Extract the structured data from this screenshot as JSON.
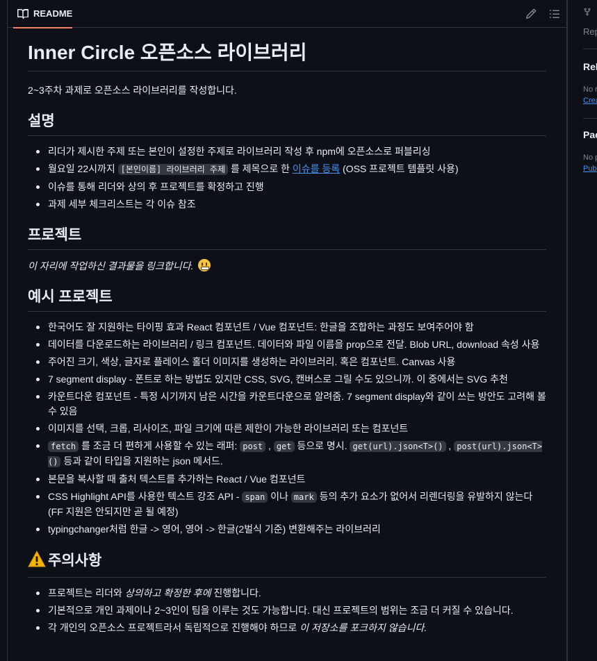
{
  "readme": {
    "tab_label": "README",
    "title": "Inner Circle 오픈소스 라이브러리",
    "intro": "2~3주차 과제로 오픈소스 라이브러리를 작성합니다.",
    "section_description": {
      "heading": "설명",
      "item1": "리더가 제시한 주제 또는 본인이 설정한 주제로 라이브러리 작성 후 npm에 오픈소스로 퍼블리싱",
      "item2_pre": "월요일 22시까지 ",
      "item2_code": "[본인이름] 라이브러리 주제",
      "item2_mid": " 를 제목으로 한 ",
      "item2_link": "이슈를 등록",
      "item2_post": " (OSS 프로젝트 템플릿 사용)",
      "item3": "이슈를 통해 리더와 상의 후 프로젝트를 확정하고 진행",
      "item4": "과제 세부 체크리스트는 각 이슈 참조"
    },
    "section_project": {
      "heading": "프로젝트",
      "note": "이 자리에 작업하신 결과물을 링크합니다."
    },
    "section_examples": {
      "heading": "예시 프로젝트",
      "e1": "한국어도 잘 지원하는 타이핑 효과 React 컴포넌트 / Vue 컴포넌트: 한글을 조합하는 과정도 보여주어야 함",
      "e2": "데이터를 다운로드하는 라이브러리 / 링크 컴포넌트. 데이터와 파일 이름을 prop으로 전달. Blob URL, download 속성 사용",
      "e3": "주어진 크기, 색상, 글자로 플레이스 홀더 이미지를 생성하는 라이브러리. 혹은 컴포넌트. Canvas 사용",
      "e4": "7 segment display - 폰트로 하는 방법도 있지만 CSS, SVG, 캔버스로 그릴 수도 있으니까. 이 중에서는 SVG 추천",
      "e5": "카운트다운 컴포넌트 - 특정 시기까지 남은 시간을 카운트다운으로 알려줌. 7 segment display와 같이 쓰는 방안도 고려해 볼 수 있음",
      "e6": "이미지를 선택, 크롭, 리사이즈, 파일 크기에 따른 제한이 가능한 라이브러리 또는 컴포넌트",
      "e7_code1": "fetch",
      "e7_a": " 를 조금 더 편하게 사용할 수 있는 래퍼: ",
      "e7_code2": "post",
      "e7_b": " , ",
      "e7_code3": "get",
      "e7_c": " 등으로 명시. ",
      "e7_code4": "get(url).json<T>()",
      "e7_d": " , ",
      "e7_code5": "post(url).json<T>()",
      "e7_e": " 등과 같이 타입을 지원하는 json 메서드.",
      "e8": "본문을 복사할 때 출처 텍스트를 추가하는 React / Vue 컴포넌트",
      "e9_a": "CSS Highlight API를 사용한 텍스트 강조 API - ",
      "e9_code1": "span",
      "e9_b": " 이나 ",
      "e9_code2": "mark",
      "e9_c": " 등의 추가 요소가 없어서 리렌더링을 유발하지 않는다(FF 지원은 안되지만 곧 될 예정)",
      "e10": "typingchanger처럼 한글 -> 영어, 영어 -> 한글(2벌식 기준) 변환해주는 라이브러리"
    },
    "section_caution": {
      "heading": "주의사항",
      "c1_a": "프로젝트는 리더와 ",
      "c1_em": "상의하고 확정한 후에",
      "c1_b": " 진행합니다.",
      "c2": "기본적으로 개인 과제이나 2~3인이 팀을 이루는 것도 가능합니다. 대신 프로젝트의 범위는 조금 더 커질 수 있습니다.",
      "c3_a": "각 개인의 오픈소스 프로젝트라서 독립적으로 진행해야 하므로 ",
      "c3_em": "이 저장소를 포크하지 않습니다."
    }
  },
  "sidebar": {
    "rep_label": "Rep",
    "releases_heading": "Rel",
    "releases_empty": "No r",
    "releases_link": "Crea",
    "packages_heading": "Pac",
    "packages_empty": "No p",
    "packages_link": "Publ"
  },
  "icons": {
    "readme_tab": "book-icon",
    "edit": "pencil-icon",
    "outline": "list-unordered-icon",
    "fork": "fork-icon",
    "warning": "warning-icon",
    "emoji": "grinning-face-icon"
  },
  "colors": {
    "background": "#0d1117",
    "border": "#30363d",
    "text": "#e6edf3",
    "muted": "#7d8590",
    "link": "#4493f8",
    "tab_underline": "#f78166"
  }
}
